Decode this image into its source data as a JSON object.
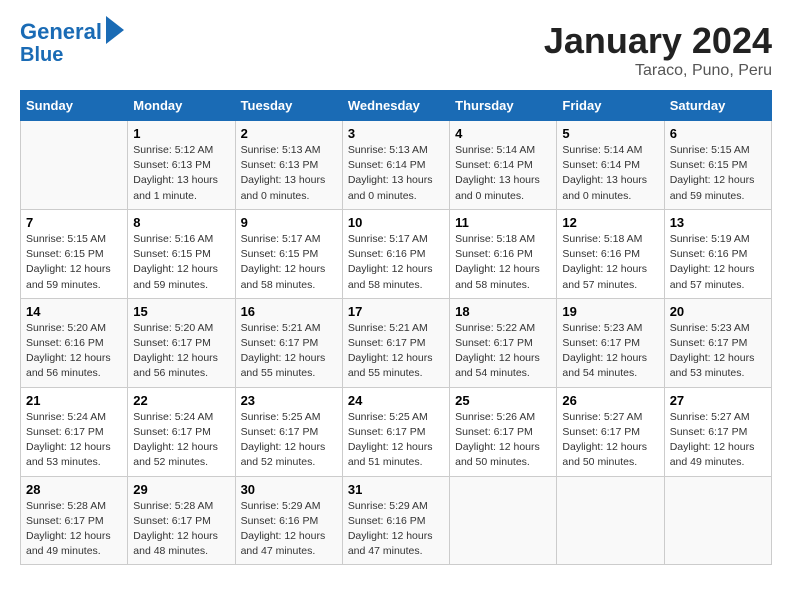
{
  "header": {
    "logo_line1": "General",
    "logo_line2": "Blue",
    "title": "January 2024",
    "subtitle": "Taraco, Puno, Peru"
  },
  "columns": [
    "Sunday",
    "Monday",
    "Tuesday",
    "Wednesday",
    "Thursday",
    "Friday",
    "Saturday"
  ],
  "weeks": [
    [
      {
        "day": "",
        "sunrise": "",
        "sunset": "",
        "daylight": ""
      },
      {
        "day": "1",
        "sunrise": "Sunrise: 5:12 AM",
        "sunset": "Sunset: 6:13 PM",
        "daylight": "Daylight: 13 hours and 1 minute."
      },
      {
        "day": "2",
        "sunrise": "Sunrise: 5:13 AM",
        "sunset": "Sunset: 6:13 PM",
        "daylight": "Daylight: 13 hours and 0 minutes."
      },
      {
        "day": "3",
        "sunrise": "Sunrise: 5:13 AM",
        "sunset": "Sunset: 6:14 PM",
        "daylight": "Daylight: 13 hours and 0 minutes."
      },
      {
        "day": "4",
        "sunrise": "Sunrise: 5:14 AM",
        "sunset": "Sunset: 6:14 PM",
        "daylight": "Daylight: 13 hours and 0 minutes."
      },
      {
        "day": "5",
        "sunrise": "Sunrise: 5:14 AM",
        "sunset": "Sunset: 6:14 PM",
        "daylight": "Daylight: 13 hours and 0 minutes."
      },
      {
        "day": "6",
        "sunrise": "Sunrise: 5:15 AM",
        "sunset": "Sunset: 6:15 PM",
        "daylight": "Daylight: 12 hours and 59 minutes."
      }
    ],
    [
      {
        "day": "7",
        "sunrise": "Sunrise: 5:15 AM",
        "sunset": "Sunset: 6:15 PM",
        "daylight": "Daylight: 12 hours and 59 minutes."
      },
      {
        "day": "8",
        "sunrise": "Sunrise: 5:16 AM",
        "sunset": "Sunset: 6:15 PM",
        "daylight": "Daylight: 12 hours and 59 minutes."
      },
      {
        "day": "9",
        "sunrise": "Sunrise: 5:17 AM",
        "sunset": "Sunset: 6:15 PM",
        "daylight": "Daylight: 12 hours and 58 minutes."
      },
      {
        "day": "10",
        "sunrise": "Sunrise: 5:17 AM",
        "sunset": "Sunset: 6:16 PM",
        "daylight": "Daylight: 12 hours and 58 minutes."
      },
      {
        "day": "11",
        "sunrise": "Sunrise: 5:18 AM",
        "sunset": "Sunset: 6:16 PM",
        "daylight": "Daylight: 12 hours and 58 minutes."
      },
      {
        "day": "12",
        "sunrise": "Sunrise: 5:18 AM",
        "sunset": "Sunset: 6:16 PM",
        "daylight": "Daylight: 12 hours and 57 minutes."
      },
      {
        "day": "13",
        "sunrise": "Sunrise: 5:19 AM",
        "sunset": "Sunset: 6:16 PM",
        "daylight": "Daylight: 12 hours and 57 minutes."
      }
    ],
    [
      {
        "day": "14",
        "sunrise": "Sunrise: 5:20 AM",
        "sunset": "Sunset: 6:16 PM",
        "daylight": "Daylight: 12 hours and 56 minutes."
      },
      {
        "day": "15",
        "sunrise": "Sunrise: 5:20 AM",
        "sunset": "Sunset: 6:17 PM",
        "daylight": "Daylight: 12 hours and 56 minutes."
      },
      {
        "day": "16",
        "sunrise": "Sunrise: 5:21 AM",
        "sunset": "Sunset: 6:17 PM",
        "daylight": "Daylight: 12 hours and 55 minutes."
      },
      {
        "day": "17",
        "sunrise": "Sunrise: 5:21 AM",
        "sunset": "Sunset: 6:17 PM",
        "daylight": "Daylight: 12 hours and 55 minutes."
      },
      {
        "day": "18",
        "sunrise": "Sunrise: 5:22 AM",
        "sunset": "Sunset: 6:17 PM",
        "daylight": "Daylight: 12 hours and 54 minutes."
      },
      {
        "day": "19",
        "sunrise": "Sunrise: 5:23 AM",
        "sunset": "Sunset: 6:17 PM",
        "daylight": "Daylight: 12 hours and 54 minutes."
      },
      {
        "day": "20",
        "sunrise": "Sunrise: 5:23 AM",
        "sunset": "Sunset: 6:17 PM",
        "daylight": "Daylight: 12 hours and 53 minutes."
      }
    ],
    [
      {
        "day": "21",
        "sunrise": "Sunrise: 5:24 AM",
        "sunset": "Sunset: 6:17 PM",
        "daylight": "Daylight: 12 hours and 53 minutes."
      },
      {
        "day": "22",
        "sunrise": "Sunrise: 5:24 AM",
        "sunset": "Sunset: 6:17 PM",
        "daylight": "Daylight: 12 hours and 52 minutes."
      },
      {
        "day": "23",
        "sunrise": "Sunrise: 5:25 AM",
        "sunset": "Sunset: 6:17 PM",
        "daylight": "Daylight: 12 hours and 52 minutes."
      },
      {
        "day": "24",
        "sunrise": "Sunrise: 5:25 AM",
        "sunset": "Sunset: 6:17 PM",
        "daylight": "Daylight: 12 hours and 51 minutes."
      },
      {
        "day": "25",
        "sunrise": "Sunrise: 5:26 AM",
        "sunset": "Sunset: 6:17 PM",
        "daylight": "Daylight: 12 hours and 50 minutes."
      },
      {
        "day": "26",
        "sunrise": "Sunrise: 5:27 AM",
        "sunset": "Sunset: 6:17 PM",
        "daylight": "Daylight: 12 hours and 50 minutes."
      },
      {
        "day": "27",
        "sunrise": "Sunrise: 5:27 AM",
        "sunset": "Sunset: 6:17 PM",
        "daylight": "Daylight: 12 hours and 49 minutes."
      }
    ],
    [
      {
        "day": "28",
        "sunrise": "Sunrise: 5:28 AM",
        "sunset": "Sunset: 6:17 PM",
        "daylight": "Daylight: 12 hours and 49 minutes."
      },
      {
        "day": "29",
        "sunrise": "Sunrise: 5:28 AM",
        "sunset": "Sunset: 6:17 PM",
        "daylight": "Daylight: 12 hours and 48 minutes."
      },
      {
        "day": "30",
        "sunrise": "Sunrise: 5:29 AM",
        "sunset": "Sunset: 6:16 PM",
        "daylight": "Daylight: 12 hours and 47 minutes."
      },
      {
        "day": "31",
        "sunrise": "Sunrise: 5:29 AM",
        "sunset": "Sunset: 6:16 PM",
        "daylight": "Daylight: 12 hours and 47 minutes."
      },
      {
        "day": "",
        "sunrise": "",
        "sunset": "",
        "daylight": ""
      },
      {
        "day": "",
        "sunrise": "",
        "sunset": "",
        "daylight": ""
      },
      {
        "day": "",
        "sunrise": "",
        "sunset": "",
        "daylight": ""
      }
    ]
  ]
}
